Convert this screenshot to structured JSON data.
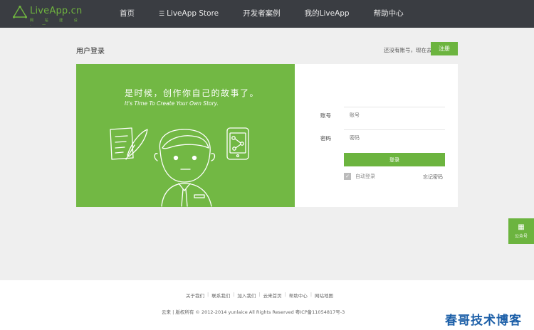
{
  "header": {
    "logo_text": "LiveApp.cn",
    "logo_sub": "网 站 建 设 · 一",
    "nav": [
      {
        "label": "首页",
        "icon": ""
      },
      {
        "label": "LiveApp Store",
        "icon": "list-icon"
      },
      {
        "label": "开发者案例",
        "icon": ""
      },
      {
        "label": "我的LiveApp",
        "icon": ""
      },
      {
        "label": "帮助中心",
        "icon": ""
      }
    ]
  },
  "page": {
    "title": "用户登录",
    "register_prompt": "还没有账号，现在去",
    "register_button": "注册"
  },
  "hero": {
    "headline_cn": "是时候，创作你自己的故事了。",
    "headline_en": "It's Time To Create Your Own Story."
  },
  "form": {
    "account_label": "账号",
    "account_placeholder": "账号",
    "password_label": "密码",
    "password_placeholder": "密码",
    "login_button": "登录",
    "remember_label": "自动登录",
    "remember_checked": true,
    "forgot_label": "忘记密码"
  },
  "wechat": {
    "label": "公众号"
  },
  "footer": {
    "links": [
      "关于我们",
      "联系我们",
      "加入我们",
      "云来首页",
      "帮助中心",
      "网站地图"
    ],
    "copyright": "云来 | 版权所有 © 2012-2014 yunlaice All Rights Reserved 粤ICP备11054817号-3"
  },
  "watermark": {
    "text": "春哥技术博客"
  },
  "colors": {
    "accent": "#6cb43f",
    "header_bg": "#3a3d42",
    "page_bg": "#efefef",
    "watermark_text": "#1c5fa8"
  }
}
